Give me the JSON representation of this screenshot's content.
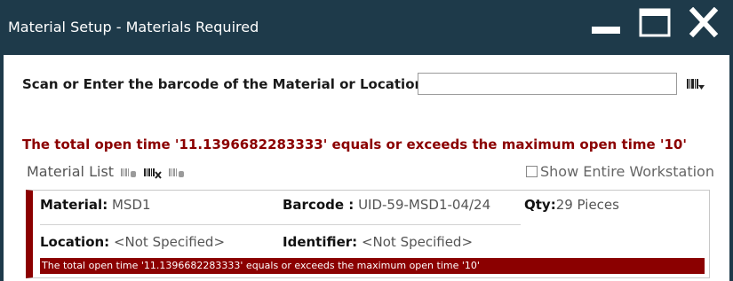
{
  "window": {
    "title": "Material Setup - Materials Required",
    "buttons": {
      "minimize_icon": "minimize-icon",
      "maximize_icon": "maximize-icon",
      "close_icon": "close-icon"
    }
  },
  "scan": {
    "label": "Scan or Enter the barcode of the Material or Location:",
    "value": "",
    "icon": "barcode-icon"
  },
  "alert": {
    "message": "The total open time '11.1396682283333' equals or exceeds the maximum open time '10'"
  },
  "material_list": {
    "header": "Material List",
    "toolbar_icons": [
      "barcode-icon",
      "barcode-remove-icon",
      "barcode-icon"
    ],
    "show_entire_label": "Show Entire Workstation",
    "show_entire_checked": false,
    "items": [
      {
        "material_label": "Material:",
        "material_value": "MSD1",
        "barcode_label": "Barcode :",
        "barcode_value": "UID-59-MSD1-04/24",
        "qty_label": "Qty:",
        "qty_value": "29 Pieces",
        "location_label": "Location:",
        "location_value": "<Not Specified>",
        "identifier_label": "Identifier:",
        "identifier_value": "<Not Specified>",
        "warning": "The total open time '11.1396682283333' equals or exceeds the maximum open time '10'"
      }
    ]
  },
  "colors": {
    "titlebar": "#1e3a4a",
    "alert": "#8b0000"
  }
}
